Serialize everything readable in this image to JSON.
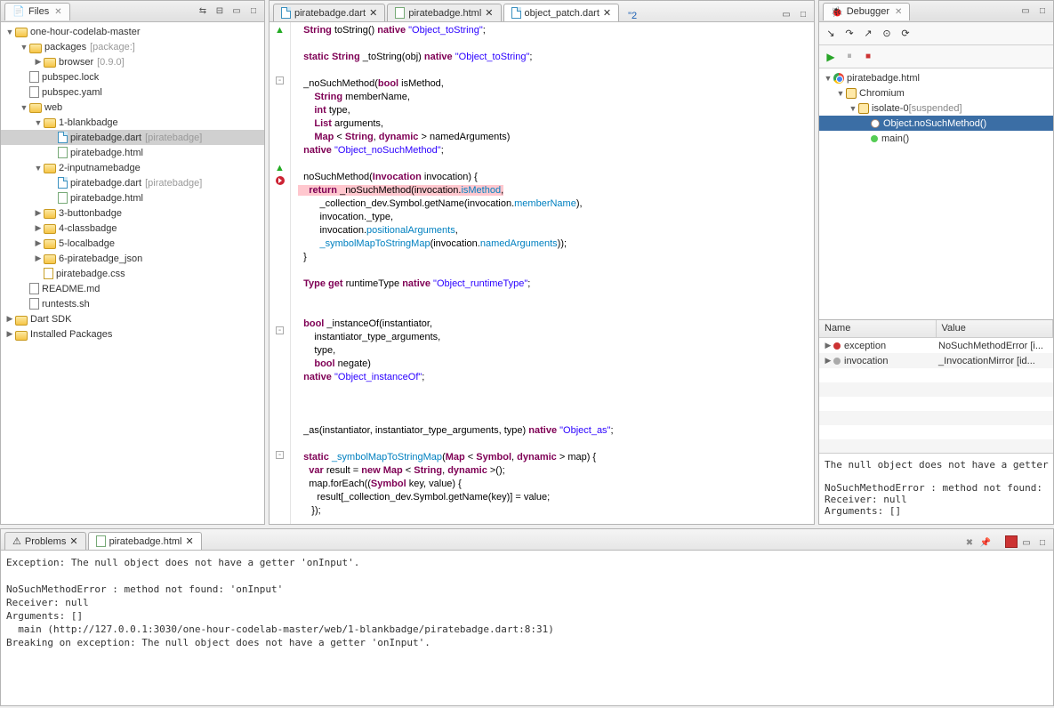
{
  "filesPanel": {
    "title": "Files",
    "tree": [
      {
        "depth": 0,
        "exp": "open",
        "icon": "folder",
        "label": "one-hour-codelab-master"
      },
      {
        "depth": 1,
        "exp": "open",
        "icon": "folder-grp",
        "label": "packages",
        "decoration": "[package:]"
      },
      {
        "depth": 2,
        "exp": "closed",
        "icon": "folder",
        "label": "browser",
        "decoration": "[0.9.0]"
      },
      {
        "depth": 1,
        "exp": "none",
        "icon": "file-generic",
        "label": "pubspec.lock"
      },
      {
        "depth": 1,
        "exp": "none",
        "icon": "file-yaml",
        "label": "pubspec.yaml"
      },
      {
        "depth": 1,
        "exp": "open",
        "icon": "folder",
        "label": "web"
      },
      {
        "depth": 2,
        "exp": "open",
        "icon": "folder",
        "label": "1-blankbadge"
      },
      {
        "depth": 3,
        "exp": "none",
        "icon": "file-dart",
        "label": "piratebadge.dart",
        "decoration": "[piratebadge]",
        "selected": true
      },
      {
        "depth": 3,
        "exp": "none",
        "icon": "file-html",
        "label": "piratebadge.html"
      },
      {
        "depth": 2,
        "exp": "open",
        "icon": "folder",
        "label": "2-inputnamebadge"
      },
      {
        "depth": 3,
        "exp": "none",
        "icon": "file-dart",
        "label": "piratebadge.dart",
        "decoration": "[piratebadge]"
      },
      {
        "depth": 3,
        "exp": "none",
        "icon": "file-html",
        "label": "piratebadge.html"
      },
      {
        "depth": 2,
        "exp": "closed",
        "icon": "folder",
        "label": "3-buttonbadge"
      },
      {
        "depth": 2,
        "exp": "closed",
        "icon": "folder",
        "label": "4-classbadge"
      },
      {
        "depth": 2,
        "exp": "closed",
        "icon": "folder",
        "label": "5-localbadge"
      },
      {
        "depth": 2,
        "exp": "closed",
        "icon": "folder",
        "label": "6-piratebadge_json"
      },
      {
        "depth": 2,
        "exp": "none",
        "icon": "file-css",
        "label": "piratebadge.css"
      },
      {
        "depth": 1,
        "exp": "none",
        "icon": "file-generic",
        "label": "README.md"
      },
      {
        "depth": 1,
        "exp": "none",
        "icon": "file-generic",
        "label": "runtests.sh"
      },
      {
        "depth": 0,
        "exp": "closed",
        "icon": "sdk",
        "label": "Dart SDK"
      },
      {
        "depth": 0,
        "exp": "closed",
        "icon": "pkg",
        "label": "Installed Packages"
      }
    ]
  },
  "editor": {
    "tabs": [
      {
        "label": "piratebadge.dart",
        "icon": "file-dart",
        "active": false
      },
      {
        "label": "piratebadge.html",
        "icon": "file-html",
        "active": false
      },
      {
        "label": "object_patch.dart",
        "icon": "file-dart",
        "active": true
      }
    ],
    "overflow": "\"2",
    "gutter": [
      "up",
      "",
      "",
      "",
      "minus",
      "",
      "",
      "",
      "",
      "",
      "",
      "up-minus",
      "bp",
      "",
      "",
      "",
      "",
      "",
      "",
      "",
      "",
      "",
      "",
      "",
      "minus",
      "",
      "",
      "",
      "",
      "",
      "",
      "",
      "",
      "",
      "minus",
      "",
      "",
      "",
      "",
      ""
    ]
  },
  "debugger": {
    "title": "Debugger",
    "callstack": [
      {
        "depth": 0,
        "exp": "open",
        "icon": "chrome",
        "label": "piratebadge.html"
      },
      {
        "depth": 1,
        "exp": "open",
        "icon": "thread",
        "label": "Chromium"
      },
      {
        "depth": 2,
        "exp": "open",
        "icon": "thread",
        "label": "isolate-0",
        "decoration": "[suspended]"
      },
      {
        "depth": 3,
        "exp": "none",
        "icon": "stack",
        "label": "Object.noSuchMethod()",
        "selected": true
      },
      {
        "depth": 3,
        "exp": "none",
        "icon": "green",
        "label": "main()"
      }
    ],
    "vars": {
      "headers": [
        "Name",
        "Value"
      ],
      "rows": [
        {
          "name": "exception",
          "value": "NoSuchMethodError [i...",
          "dot": "red"
        },
        {
          "name": "invocation",
          "value": "_InvocationMirror [id...",
          "dot": "gray"
        }
      ]
    },
    "errtext": "The null object does not have a getter\n\nNoSuchMethodError : method not found:\nReceiver: null\nArguments: []"
  },
  "bottom": {
    "tabs": [
      {
        "label": "Problems",
        "icon": "problems",
        "active": false
      },
      {
        "label": "piratebadge.html",
        "icon": "file-html",
        "active": true
      }
    ],
    "console": "Exception: The null object does not have a getter 'onInput'.\n\nNoSuchMethodError : method not found: 'onInput'\nReceiver: null\nArguments: []\n  main (http://127.0.0.1:3030/one-hour-codelab-master/web/1-blankbadge/piratebadge.dart:8:31)\nBreaking on exception: The null object does not have a getter 'onInput'."
  }
}
